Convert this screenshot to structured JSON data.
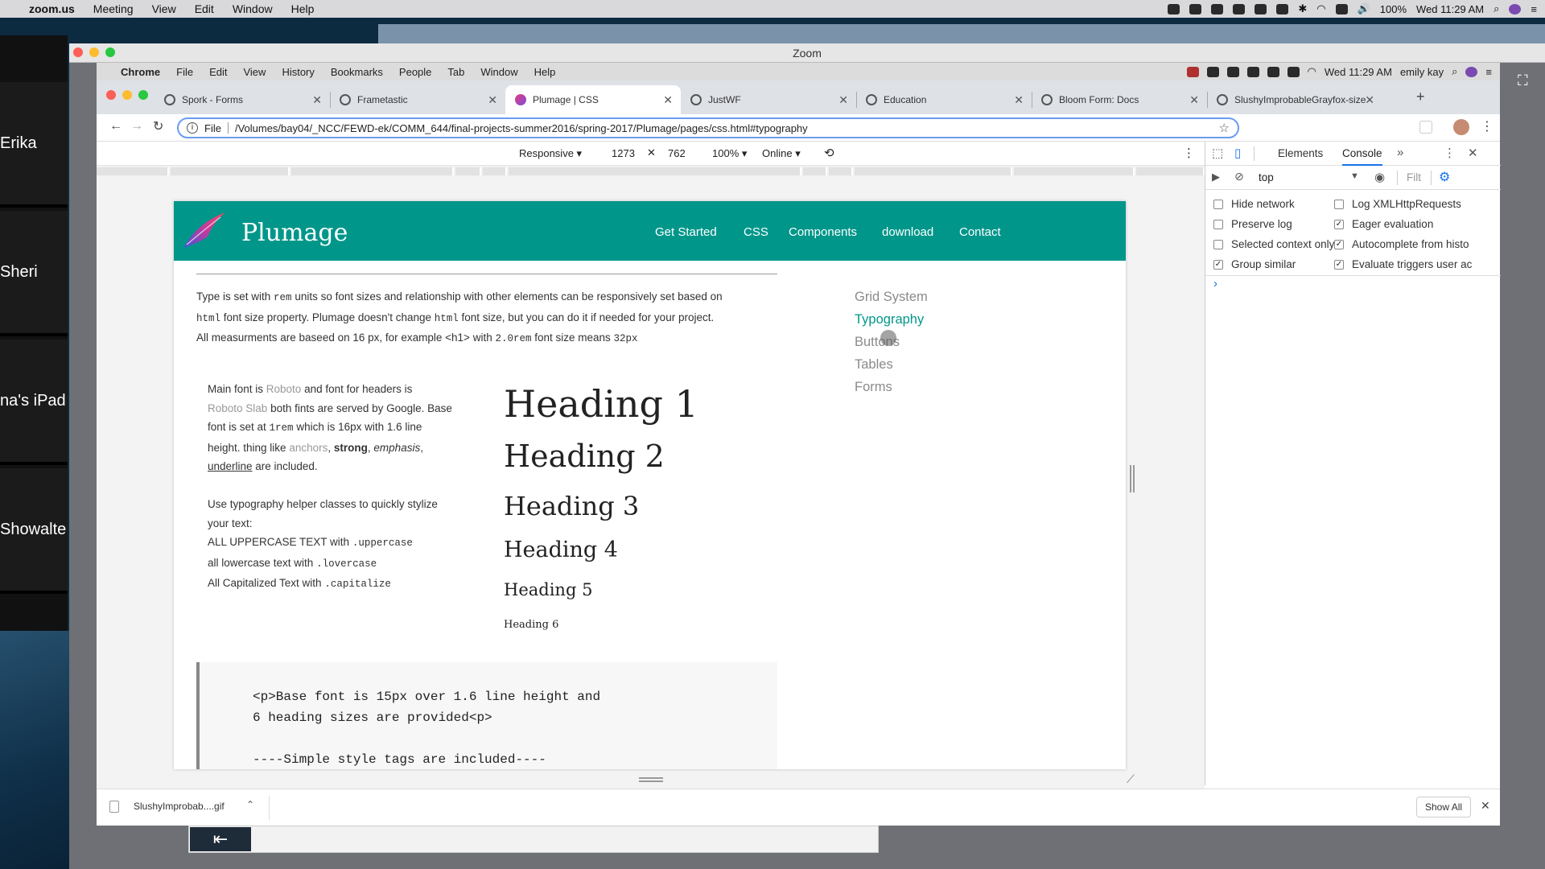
{
  "menubar": {
    "app": "zoom.us",
    "items": [
      "Meeting",
      "View",
      "Edit",
      "Window",
      "Help"
    ],
    "battery": "100%",
    "clock": "Wed 11:29 AM"
  },
  "zoom": {
    "window_title": "Zoom",
    "participants": [
      "Erika",
      "Sheri",
      "na's iPad",
      "Showalte"
    ]
  },
  "chrome_menubar": {
    "app": "Chrome",
    "items": [
      "File",
      "Edit",
      "View",
      "History",
      "Bookmarks",
      "People",
      "Tab",
      "Window",
      "Help"
    ],
    "clock": "Wed 11:29 AM",
    "user": "emily kay"
  },
  "tabs": [
    {
      "label": "Spork - Forms"
    },
    {
      "label": "Frametastic"
    },
    {
      "label": "Plumage | CSS"
    },
    {
      "label": "JustWF"
    },
    {
      "label": "Education"
    },
    {
      "label": "Bloom Form: Docs"
    },
    {
      "label": "SlushyImprobableGrayfox-size"
    }
  ],
  "address": {
    "scheme": "File",
    "url": "/Volumes/bay04/_NCC/FEWD-ek/COMM_644/final-projects-summer2016/spring-2017/Plumage/pages/css.html#typography"
  },
  "device_toolbar": {
    "device": "Responsive",
    "width": "1273",
    "height": "762",
    "zoom": "100%",
    "network": "Online"
  },
  "site": {
    "brand": "Plumage",
    "nav": [
      "Get Started",
      "CSS",
      "Components",
      "download",
      "Contact"
    ],
    "intro": {
      "t1": "Type is set with ",
      "c1": "rem",
      "t2": " units so font sizes and relationship with other elements can be responsively set based on",
      "c2": "html",
      "t3": " font size property. Plumage doesn't change ",
      "c3": "html",
      "t4": " font size, but you can do it if needed for your project.",
      "t5": "All measurments are baseed on 16 px, for example <h1> with ",
      "c4": "2.0rem",
      "t6": " font size means ",
      "c5": "32px"
    },
    "fonts_para": {
      "t1": "Main font is ",
      "roboto": "Roboto",
      "t2": " and font for headers is",
      "roboto_slab": "Roboto Slab",
      "t3": " both fints are served by Google. Base",
      "t4": "font is set at ",
      "c1": "1rem",
      "t5": " which is 16px with 1.6 line",
      "t6": "height. thing like ",
      "anchors": "anchors",
      "comma": ",",
      "strong": "strong",
      "emphasis": "emphasis",
      "comma2": ",",
      "underline": "underline",
      "t7": " are included."
    },
    "helpers_para": {
      "t1": "Use typography helper classes to quickly stylize",
      "t2": "your text:",
      "upper": "ALL UPPERCASE TEXT with ",
      "upper_code": ".uppercase",
      "lower": "all lowercase text with ",
      "lower_code": ".lovercase",
      "cap": "All Capitalized Text with ",
      "cap_code": ".capitalize"
    },
    "headings": [
      "Heading 1",
      "Heading 2",
      "Heading 3",
      "Heading 4",
      "Heading 5",
      "Heading 6"
    ],
    "side_nav": [
      "Grid System",
      "Typography",
      "Buttons",
      "Tables",
      "Forms"
    ],
    "side_active": "Typography",
    "code_lines": [
      "<p>Base font is 15px over 1.6 line height and",
      "6 heading sizes are provided<p>",
      "----Simple style tags are included----"
    ],
    "accent": "#00968a"
  },
  "devtools": {
    "tabs": [
      "Elements",
      "Console"
    ],
    "active_tab": "Console",
    "more": "»",
    "context": "top",
    "filter": "Filt",
    "options": [
      {
        "label": "Hide network",
        "checked": false
      },
      {
        "label": "Log XMLHttpRequests",
        "checked": false
      },
      {
        "label": "Preserve log",
        "checked": false
      },
      {
        "label": "Eager evaluation",
        "checked": true
      },
      {
        "label": "Selected context only",
        "checked": false
      },
      {
        "label": "Autocomplete from histo",
        "checked": true
      },
      {
        "label": "Group similar",
        "checked": true
      },
      {
        "label": "Evaluate triggers user ac",
        "checked": true
      }
    ],
    "prompt": "›"
  },
  "download": {
    "file": "SlushyImprobab....gif",
    "show_all": "Show All"
  }
}
